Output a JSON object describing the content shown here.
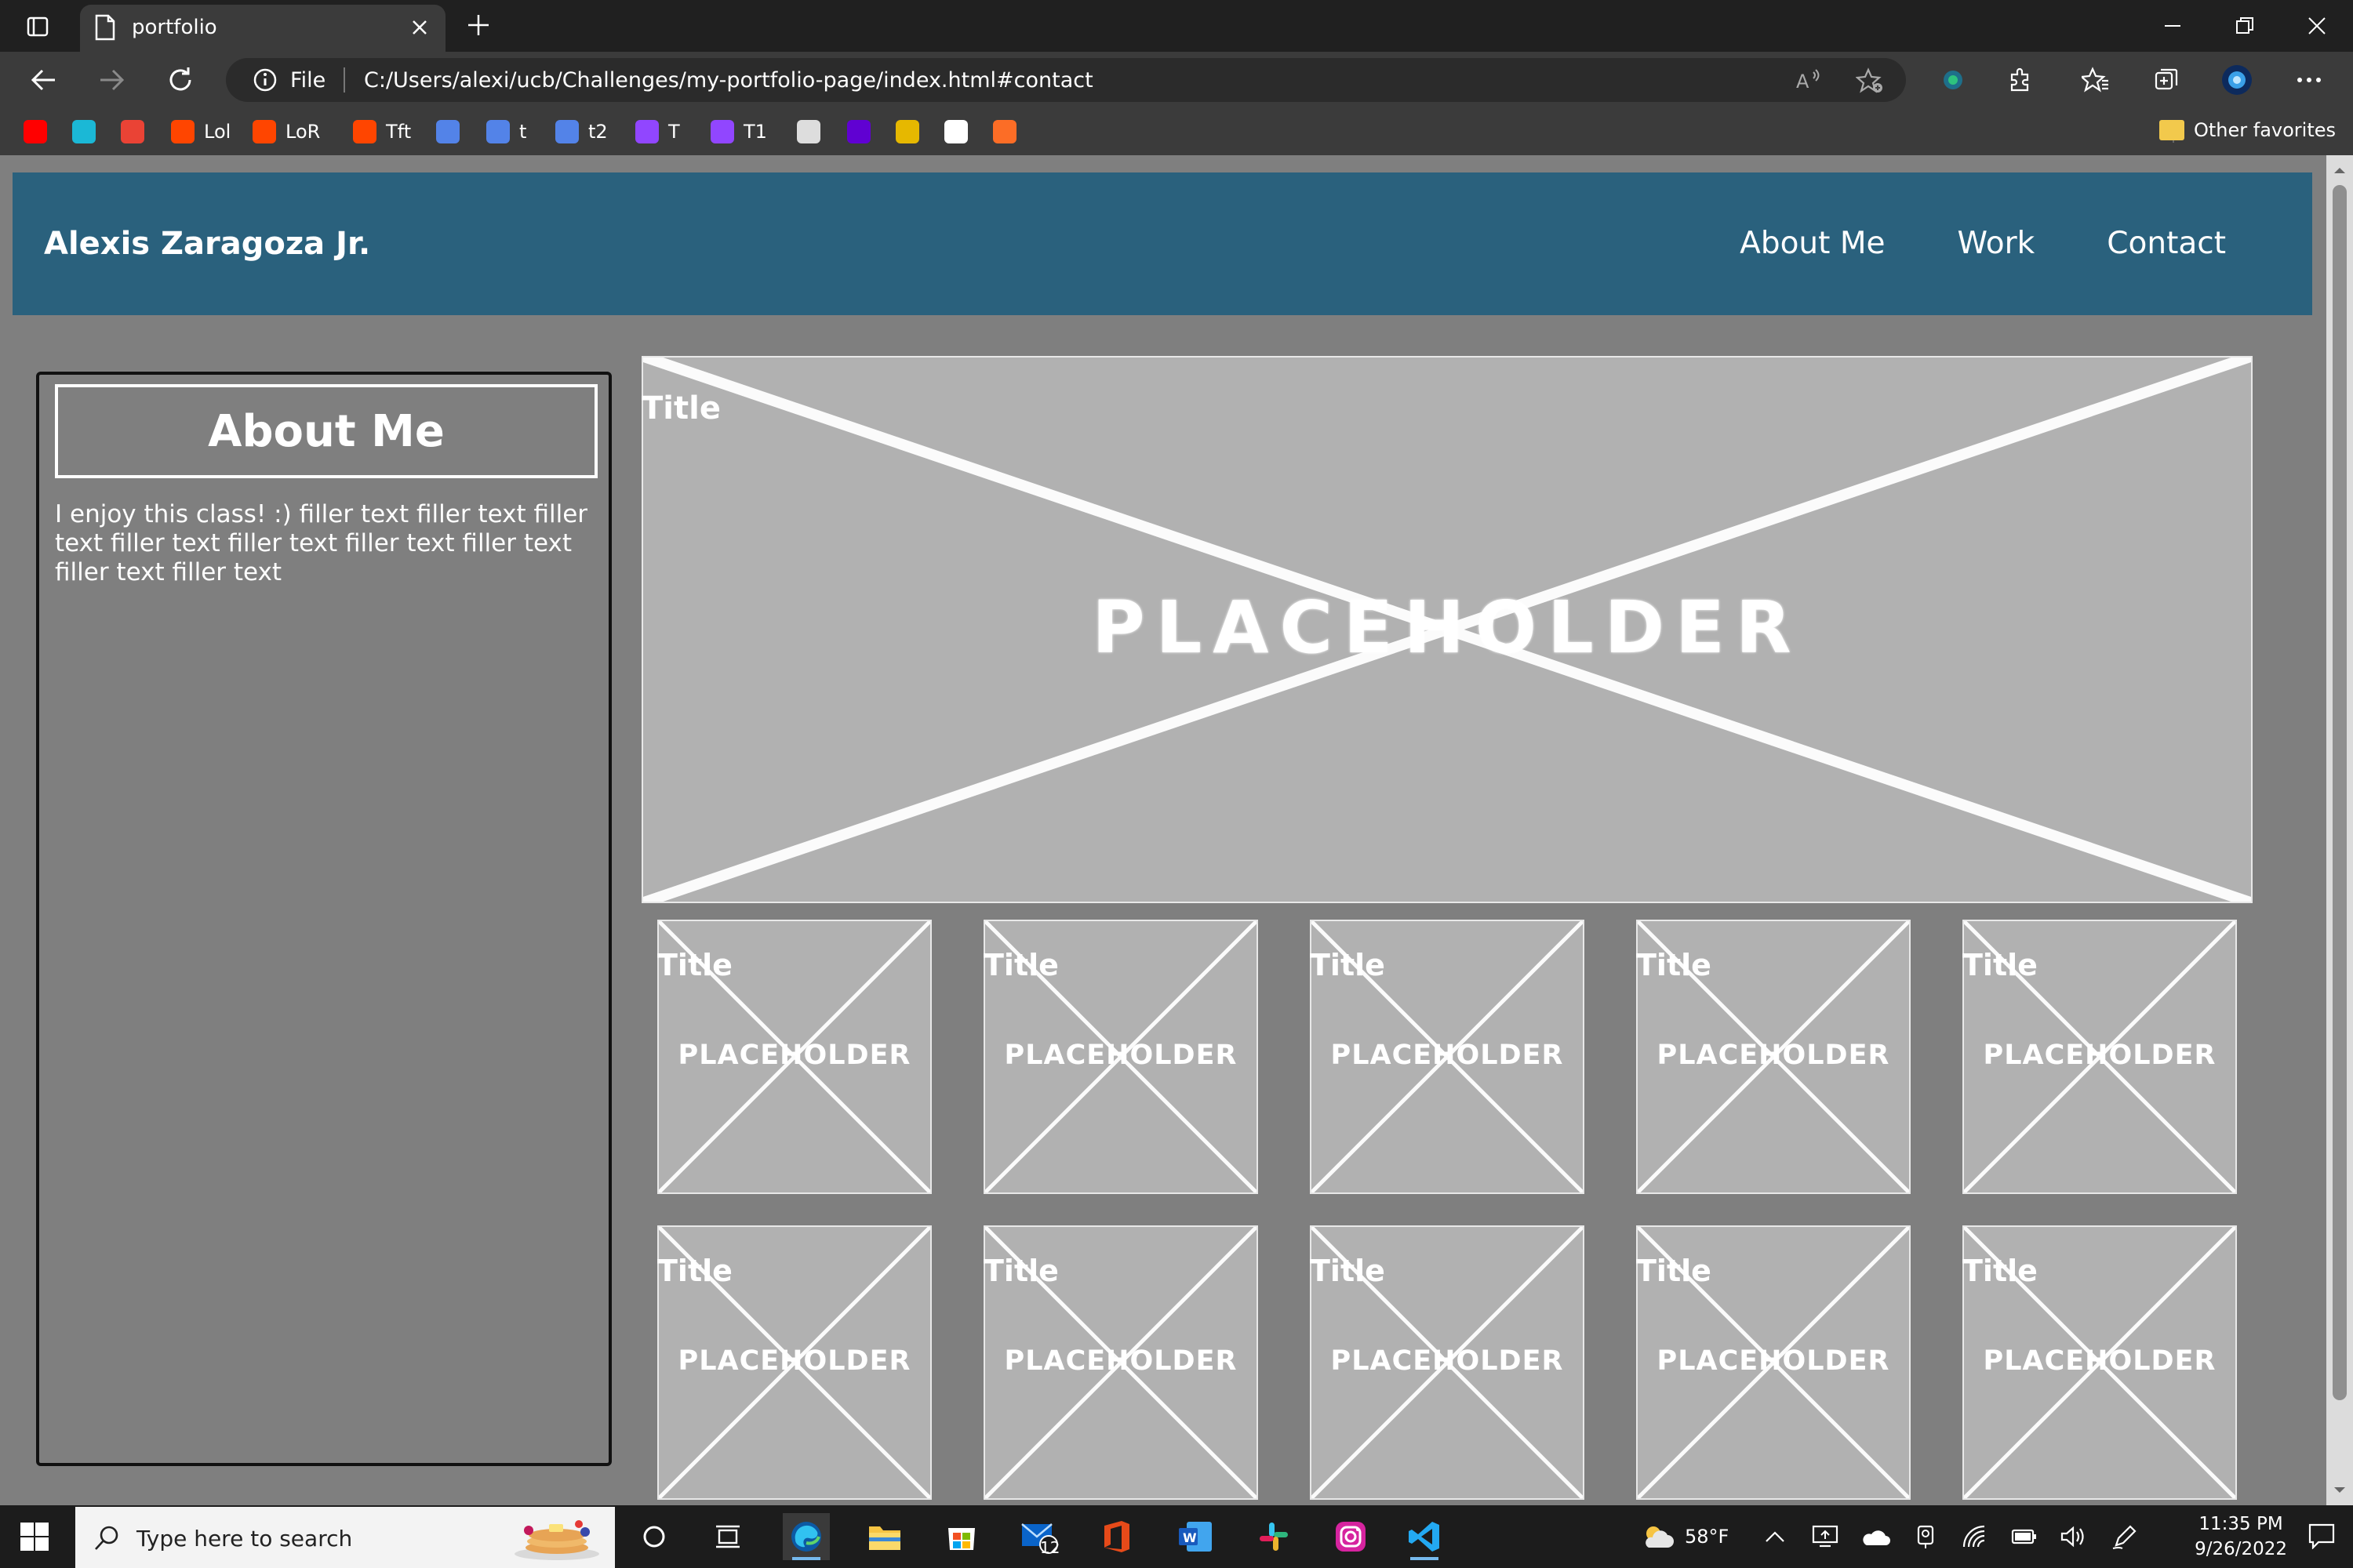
{
  "browser": {
    "tab_title": "portfolio",
    "address_scheme": "File",
    "address_url": "C:/Users/alexi/ucb/Challenges/my-portfolio-page/index.html#contact",
    "bookmarks": [
      {
        "label": "",
        "icon": "youtube-icon",
        "color": "#ff0000"
      },
      {
        "label": "",
        "icon": "expand-icon",
        "color": "#1bb8d6"
      },
      {
        "label": "",
        "icon": "gmail-icon",
        "color": "#ea4335"
      },
      {
        "label": "Lol",
        "icon": "reddit-icon",
        "color": "#ff4500"
      },
      {
        "label": "LoR",
        "icon": "reddit-icon",
        "color": "#ff4500"
      },
      {
        "label": "Tft",
        "icon": "reddit-icon",
        "color": "#ff4500"
      },
      {
        "label": "",
        "icon": "opgg-icon",
        "color": "#5383e8"
      },
      {
        "label": "t",
        "icon": "opgg-icon",
        "color": "#5383e8"
      },
      {
        "label": "t2",
        "icon": "opgg-icon",
        "color": "#5383e8"
      },
      {
        "label": "T",
        "icon": "twitch-icon",
        "color": "#9146ff"
      },
      {
        "label": "T1",
        "icon": "twitch-icon",
        "color": "#9146ff"
      },
      {
        "label": "",
        "icon": "tux-icon",
        "color": "#dddddd"
      },
      {
        "label": "",
        "icon": "yahoo-icon",
        "color": "#6001d2"
      },
      {
        "label": "",
        "icon": "coin-icon",
        "color": "#e6b800"
      },
      {
        "label": "",
        "icon": "github-icon",
        "color": "#ffffff"
      },
      {
        "label": "",
        "icon": "gitlab-icon",
        "color": "#fc6d26"
      }
    ],
    "other_favorites": "Other favorites"
  },
  "site": {
    "name": "Alexis Zaragoza Jr.",
    "nav": [
      "About Me",
      "Work",
      "Contact"
    ],
    "header_color": "#2a617d",
    "background_color": "#7f7f7f"
  },
  "about": {
    "heading": "About Me",
    "text": "I enjoy this class! :) filler text filler text filler text filler text filler text filler text filler text filler text filler text"
  },
  "work": {
    "featured": {
      "title": "Title",
      "image_text": "PLACEHOLDER"
    },
    "items": [
      {
        "title": "Title",
        "image_text": "PLACEHOLDER"
      },
      {
        "title": "Title",
        "image_text": "PLACEHOLDER"
      },
      {
        "title": "Title",
        "image_text": "PLACEHOLDER"
      },
      {
        "title": "Title",
        "image_text": "PLACEHOLDER"
      },
      {
        "title": "Title",
        "image_text": "PLACEHOLDER"
      },
      {
        "title": "Title",
        "image_text": "PLACEHOLDER"
      },
      {
        "title": "Title",
        "image_text": "PLACEHOLDER"
      },
      {
        "title": "Title",
        "image_text": "PLACEHOLDER"
      },
      {
        "title": "Title",
        "image_text": "PLACEHOLDER"
      },
      {
        "title": "Title",
        "image_text": "PLACEHOLDER"
      }
    ]
  },
  "taskbar": {
    "search_placeholder": "Type here to search",
    "mail_badge": "12",
    "weather": "58°F",
    "time": "11:35 PM",
    "date": "9/26/2022"
  }
}
